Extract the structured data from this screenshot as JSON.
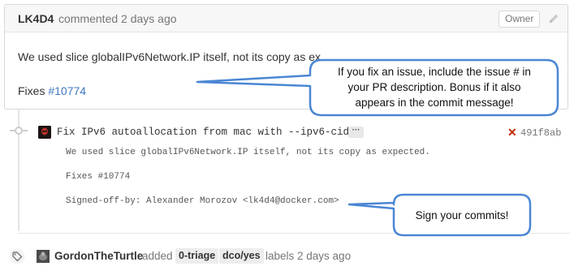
{
  "comment": {
    "author": "LK4D4",
    "meta": "commented 2 days ago",
    "owner_badge": "Owner",
    "body_text": "We used slice globalIPv6Network.IP itself, not its copy as ex",
    "fixes_prefix": "Fixes ",
    "fixes_link": "#10774"
  },
  "commit": {
    "title": "Fix IPv6 autoallocation from mac with --ipv6-cidr",
    "ellipsis": "···",
    "status_icon": "x-icon",
    "status_color": "#bd2c00",
    "sha": "491f8ab",
    "description": [
      "We used slice globalIPv6Network.IP itself, not its copy as expected.",
      "Fixes #10774",
      "Signed-off-by: Alexander Morozov <lk4d4@docker.com>"
    ]
  },
  "label_event": {
    "user": "GordonTheTurtle",
    "verb": "added",
    "labels": [
      "0-triage",
      "dco/yes"
    ],
    "tail": "labels 2 days ago"
  },
  "callouts": {
    "issue_note": [
      "If you fix an issue, include the issue # in",
      "your PR description.  Bonus if it also",
      "appears in the commit message!"
    ],
    "sign_note": "Sign your commits!"
  },
  "colors": {
    "link": "#4078c0",
    "callout_border": "#4a86d4",
    "callout_fill": "#ffffff"
  }
}
